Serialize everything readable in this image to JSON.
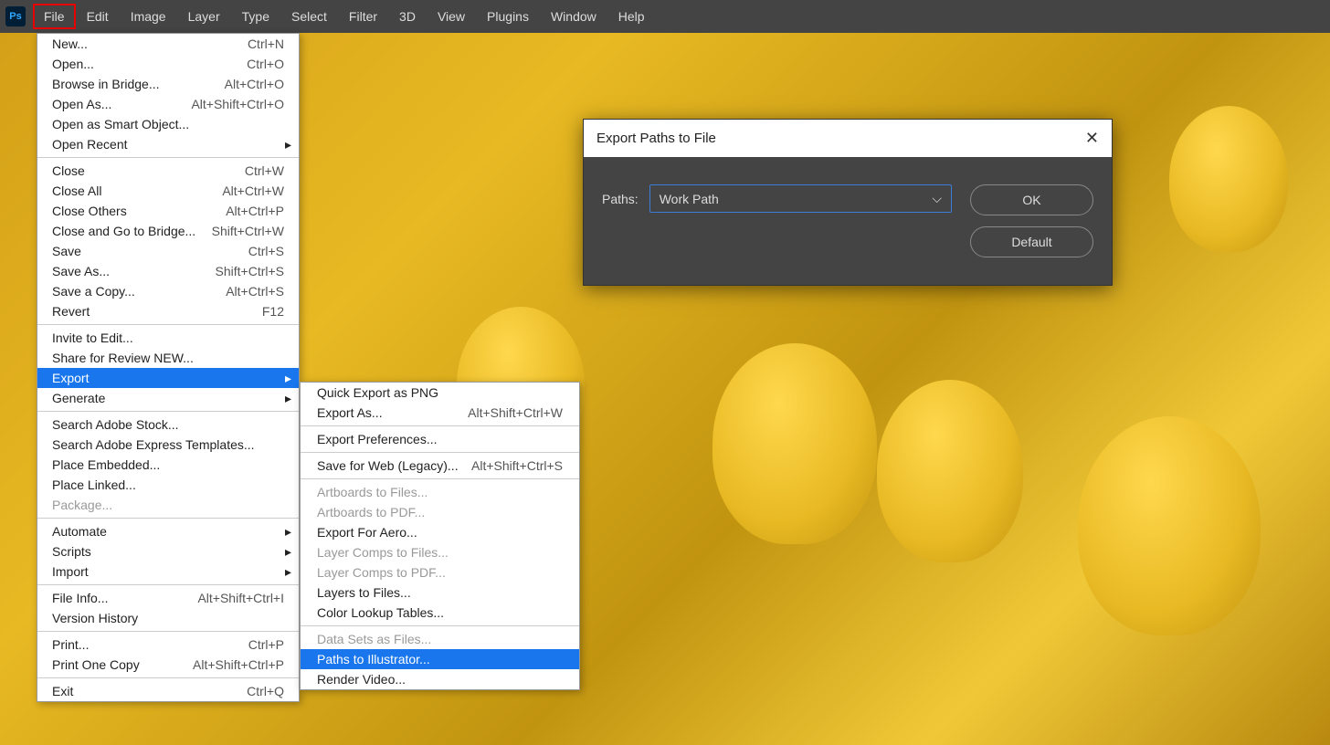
{
  "app": {
    "logo": "Ps"
  },
  "menubar": [
    "File",
    "Edit",
    "Image",
    "Layer",
    "Type",
    "Select",
    "Filter",
    "3D",
    "View",
    "Plugins",
    "Window",
    "Help"
  ],
  "fileMenu": {
    "g1": [
      {
        "label": "New...",
        "shortcut": "Ctrl+N"
      },
      {
        "label": "Open...",
        "shortcut": "Ctrl+O"
      },
      {
        "label": "Browse in Bridge...",
        "shortcut": "Alt+Ctrl+O"
      },
      {
        "label": "Open As...",
        "shortcut": "Alt+Shift+Ctrl+O"
      },
      {
        "label": "Open as Smart Object..."
      },
      {
        "label": "Open Recent",
        "arrow": true
      }
    ],
    "g2": [
      {
        "label": "Close",
        "shortcut": "Ctrl+W"
      },
      {
        "label": "Close All",
        "shortcut": "Alt+Ctrl+W"
      },
      {
        "label": "Close Others",
        "shortcut": "Alt+Ctrl+P"
      },
      {
        "label": "Close and Go to Bridge...",
        "shortcut": "Shift+Ctrl+W"
      },
      {
        "label": "Save",
        "shortcut": "Ctrl+S"
      },
      {
        "label": "Save As...",
        "shortcut": "Shift+Ctrl+S"
      },
      {
        "label": "Save a Copy...",
        "shortcut": "Alt+Ctrl+S"
      },
      {
        "label": "Revert",
        "shortcut": "F12"
      }
    ],
    "g3": [
      {
        "label": "Invite to Edit..."
      },
      {
        "label": "Share for Review NEW..."
      },
      {
        "label": "Export",
        "arrow": true,
        "selected": true
      },
      {
        "label": "Generate",
        "arrow": true
      }
    ],
    "g4": [
      {
        "label": "Search Adobe Stock..."
      },
      {
        "label": "Search Adobe Express Templates..."
      },
      {
        "label": "Place Embedded..."
      },
      {
        "label": "Place Linked..."
      },
      {
        "label": "Package...",
        "disabled": true
      }
    ],
    "g5": [
      {
        "label": "Automate",
        "arrow": true
      },
      {
        "label": "Scripts",
        "arrow": true
      },
      {
        "label": "Import",
        "arrow": true
      }
    ],
    "g6": [
      {
        "label": "File Info...",
        "shortcut": "Alt+Shift+Ctrl+I"
      },
      {
        "label": "Version History"
      }
    ],
    "g7": [
      {
        "label": "Print...",
        "shortcut": "Ctrl+P"
      },
      {
        "label": "Print One Copy",
        "shortcut": "Alt+Shift+Ctrl+P"
      }
    ],
    "g8": [
      {
        "label": "Exit",
        "shortcut": "Ctrl+Q"
      }
    ]
  },
  "exportMenu": {
    "g1": [
      {
        "label": "Quick Export as PNG"
      },
      {
        "label": "Export As...",
        "shortcut": "Alt+Shift+Ctrl+W"
      }
    ],
    "g2": [
      {
        "label": "Export Preferences..."
      }
    ],
    "g3": [
      {
        "label": "Save for Web (Legacy)...",
        "shortcut": "Alt+Shift+Ctrl+S"
      }
    ],
    "g4": [
      {
        "label": "Artboards to Files...",
        "disabled": true
      },
      {
        "label": "Artboards to PDF...",
        "disabled": true
      },
      {
        "label": "Export For Aero..."
      },
      {
        "label": "Layer Comps to Files...",
        "disabled": true
      },
      {
        "label": "Layer Comps to PDF...",
        "disabled": true
      },
      {
        "label": "Layers to Files..."
      },
      {
        "label": "Color Lookup Tables..."
      }
    ],
    "g5": [
      {
        "label": "Data Sets as Files...",
        "disabled": true
      },
      {
        "label": "Paths to Illustrator...",
        "selected": true
      },
      {
        "label": "Render Video..."
      }
    ]
  },
  "dialog": {
    "title": "Export Paths to File",
    "fieldLabel": "Paths:",
    "fieldValue": "Work Path",
    "ok": "OK",
    "default": "Default"
  }
}
